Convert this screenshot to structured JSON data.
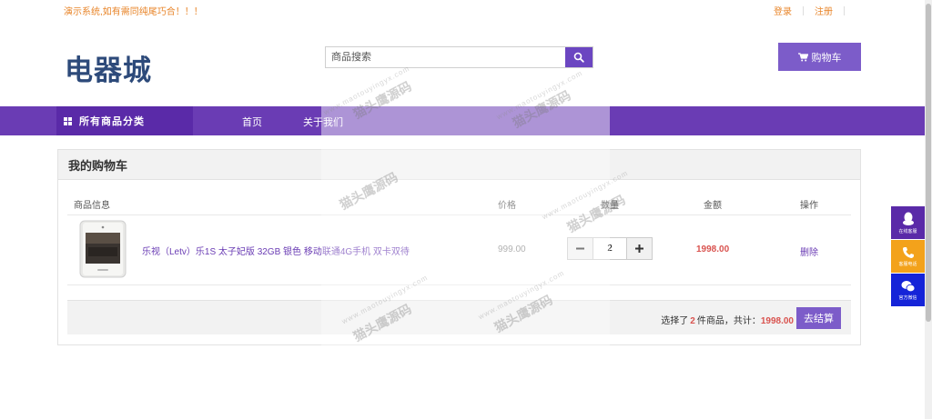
{
  "topbar": {
    "notice": "演示系统,如有需同纯尾巧合！！！",
    "login": "登录",
    "register": "注册"
  },
  "header": {
    "logo": "电器城",
    "search_placeholder": "商品搜索",
    "cart_label": "购物车"
  },
  "nav": {
    "categories_label": "所有商品分类",
    "links": [
      "首页",
      "关于我们"
    ]
  },
  "cart": {
    "title": "我的购物车",
    "columns": {
      "info": "商品信息",
      "price": "价格",
      "quantity": "数量",
      "amount": "金额",
      "action": "操作"
    },
    "items": [
      {
        "name": "乐视（Letv）乐1S 太子妃版 32GB 银色 移动联通4G手机 双卡双待",
        "price": "999.00",
        "quantity": "2",
        "amount": "1998.00",
        "delete_label": "删除"
      }
    ],
    "summary": {
      "prefix": "选择了",
      "count": "2",
      "middle": "件商品，共计：",
      "total": "1998.00"
    },
    "checkout_label": "去结算"
  },
  "float_bar": {
    "online_service": "在线客服",
    "service_phone": "客服电话",
    "wechat": "官方微信"
  },
  "watermark": {
    "cn": "猫头鹰源码",
    "en": "www.maotouyingyx.com"
  },
  "colors": {
    "brand_purple": "#6a3cb4",
    "button_purple": "#7c5cc9",
    "price_red": "#d9534f",
    "notice_orange": "#e8852a"
  }
}
